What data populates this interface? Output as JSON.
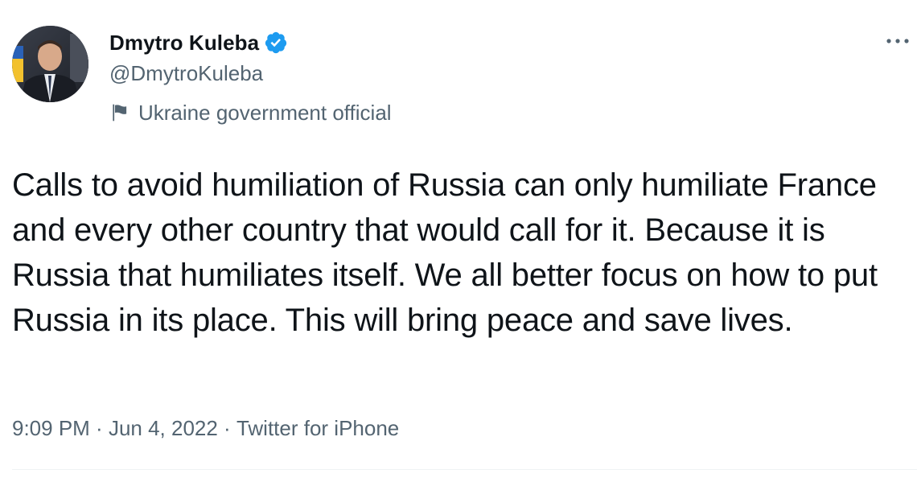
{
  "author": {
    "display_name": "Dmytro Kuleba",
    "handle": "@DmytroKuleba",
    "verified": true,
    "label": "Ukraine government official"
  },
  "tweet": {
    "text": "Calls to avoid humiliation of Russia can only humiliate France and every other country that would call for it. Because it is Russia that humiliates itself. We all better focus on how to put Russia in its place. This will bring peace and save lives."
  },
  "meta": {
    "time": "9:09 PM",
    "separator": " · ",
    "date": "Jun 4, 2022",
    "source": "Twitter for iPhone"
  },
  "icons": {
    "verified": "verified-badge-icon",
    "label_flag": "flag-icon",
    "more": "more-horizontal-icon"
  },
  "colors": {
    "text_primary": "#0f1419",
    "text_secondary": "#536471",
    "verified_blue": "#1d9bf0",
    "divider": "#eff3f4"
  }
}
